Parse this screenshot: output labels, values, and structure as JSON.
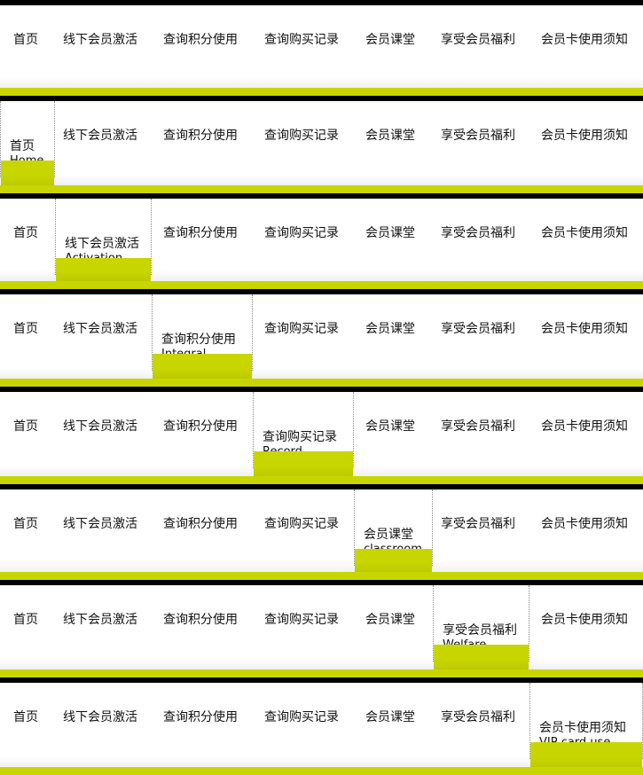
{
  "menu": {
    "items": [
      {
        "label": "首页",
        "sub": "Home"
      },
      {
        "label": "线下会员激活",
        "sub": "Activation"
      },
      {
        "label": "查询积分使用",
        "sub": "Integral"
      },
      {
        "label": "查询购买记录",
        "sub": "Record"
      },
      {
        "label": "会员课堂",
        "sub": "classroom"
      },
      {
        "label": "享受会员福利",
        "sub": "Welfare"
      },
      {
        "label": "会员卡使用须知",
        "sub": "VIP card use"
      }
    ],
    "colors": {
      "accent": "#c8d600",
      "topbar": "#000000"
    }
  },
  "states": [
    {
      "active": null
    },
    {
      "active": 0
    },
    {
      "active": 1
    },
    {
      "active": 2
    },
    {
      "active": 3
    },
    {
      "active": 4
    },
    {
      "active": 5
    },
    {
      "active": 6
    }
  ]
}
